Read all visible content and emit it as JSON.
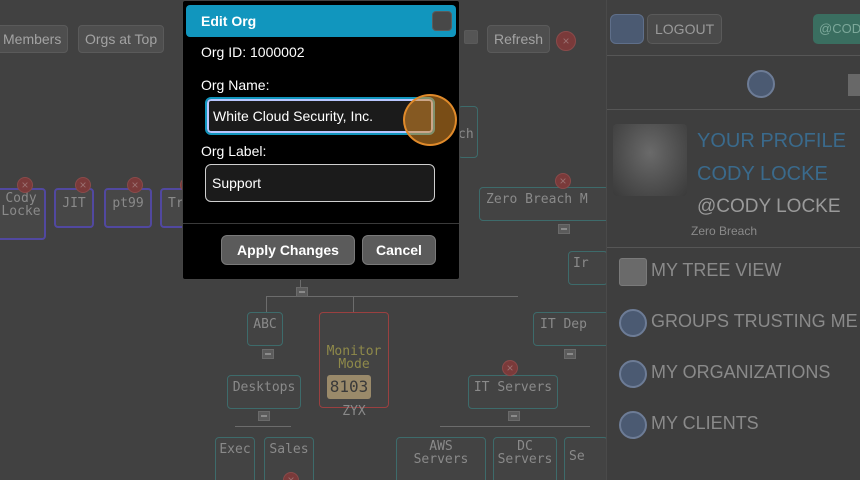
{
  "toolbar": {
    "members_label": "Members",
    "orgs_at_top_label": "Orgs at Top",
    "refresh_label": "Refresh"
  },
  "tree": {
    "nodes": {
      "cody_locke": "Cody\nLocke",
      "jit": "JIT",
      "pt99": "pt99",
      "tr": "Tr",
      "ch": "ch",
      "zero_breach": "Zero Breach M",
      "ir": "Ir",
      "abc": "ABC",
      "monitor_mode": "Monitor\nMode",
      "zyx": "ZYX",
      "zyx_count": "8103",
      "it_dep": "IT Dep",
      "desktops": "Desktops",
      "it_servers": "IT Servers",
      "exec": "Exec",
      "sales": "Sales",
      "aws_servers": "AWS\nServers",
      "dc_servers": "DC\nServers",
      "se": "Se"
    }
  },
  "sidebar": {
    "logout_label": "LOGOUT",
    "user_chip": "@CODY",
    "profile": {
      "your_profile": "YOUR PROFILE",
      "name": "CODY LOCKE",
      "handle": "@CODY LOCKE",
      "org": "Zero Breach"
    },
    "menu": [
      {
        "label": "MY TREE VIEW",
        "icon": "tree-view-icon"
      },
      {
        "label": "GROUPS TRUSTING ME",
        "icon": "groups-icon"
      },
      {
        "label": "MY ORGANIZATIONS",
        "icon": "organizations-icon"
      },
      {
        "label": "MY CLIENTS",
        "icon": "clients-icon"
      }
    ]
  },
  "dialog": {
    "title": "Edit Org",
    "org_id_text": "Org ID: 1000002",
    "org_name_label": "Org Name:",
    "org_name_value": "White Cloud Security, Inc.",
    "org_label_label": "Org Label:",
    "org_label_value": "Support",
    "apply_label": "Apply Changes",
    "cancel_label": "Cancel"
  },
  "colors": {
    "dialog_header": "#1196be",
    "focus_ring": "#1196be",
    "cursor_highlight": "#e08a2a",
    "profile_link": "#3a6a8c"
  }
}
